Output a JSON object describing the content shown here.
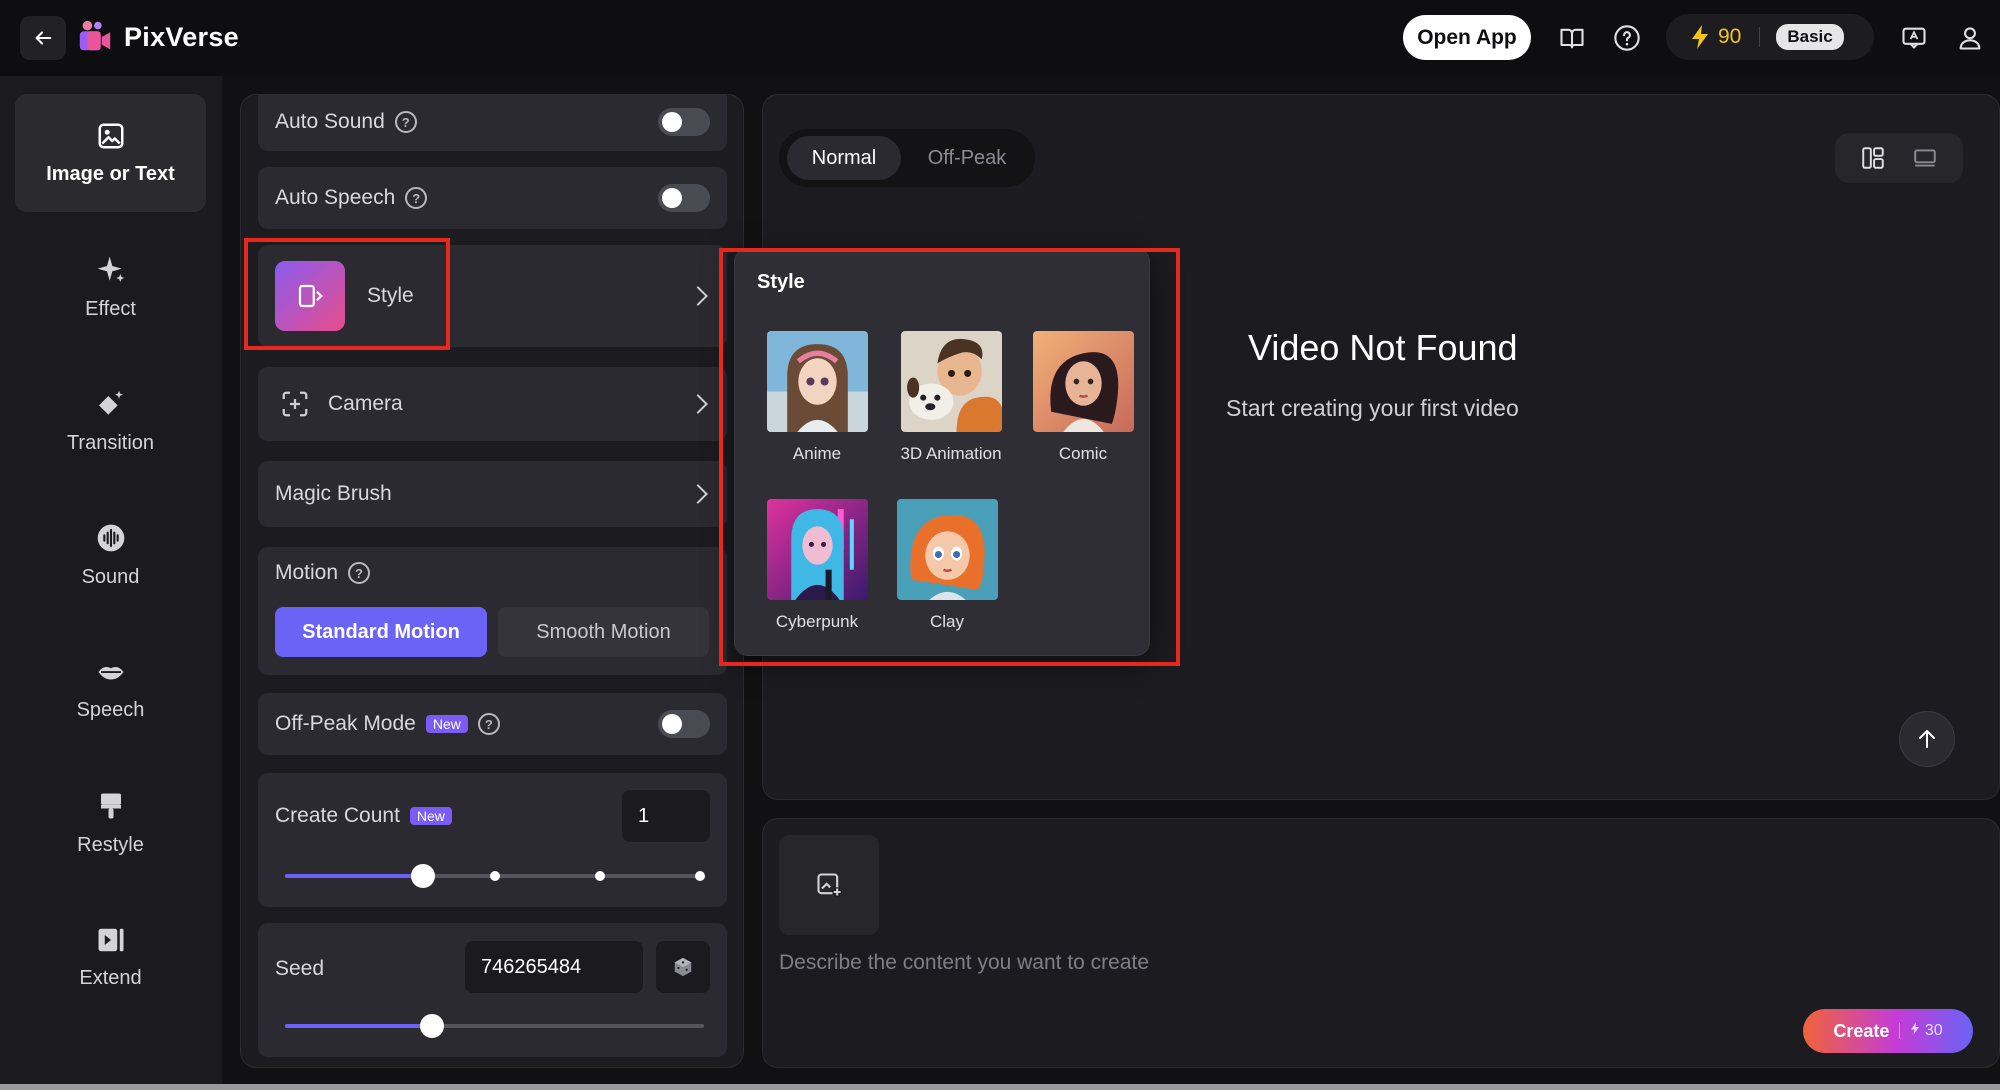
{
  "header": {
    "brand": "PixVerse",
    "open_app_label": "Open App",
    "credits_value": "90",
    "plan_label": "Basic",
    "icons": [
      "back-arrow-icon",
      "book-icon",
      "help-icon",
      "lightning-icon",
      "feedback-icon",
      "user-icon"
    ]
  },
  "rail": {
    "items": [
      {
        "label": "Image or Text",
        "icon": "image-icon"
      },
      {
        "label": "Effect",
        "icon": "sparkle-icon"
      },
      {
        "label": "Transition",
        "icon": "transition-icon"
      },
      {
        "label": "Sound",
        "icon": "sound-icon"
      },
      {
        "label": "Speech",
        "icon": "lips-icon"
      },
      {
        "label": "Restyle",
        "icon": "brush-icon"
      },
      {
        "label": "Extend",
        "icon": "extend-icon"
      }
    ]
  },
  "settings": {
    "auto_sound_label": "Auto Sound",
    "auto_speech_label": "Auto Speech",
    "style_label": "Style",
    "camera_label": "Camera",
    "magic_brush_label": "Magic Brush",
    "motion_label": "Motion",
    "motion_options": [
      "Standard Motion",
      "Smooth Motion"
    ],
    "off_peak_label": "Off-Peak Mode",
    "new_badge": "New",
    "create_count_label": "Create Count",
    "create_count_value": "1",
    "create_count_level": 0.33,
    "seed_label": "Seed",
    "seed_value": "746265484",
    "seed_level": 0.35
  },
  "preview": {
    "tabs": [
      "Normal",
      "Off-Peak"
    ],
    "empty_title": "Video Not Found",
    "empty_subtitle": "Start creating your first video"
  },
  "style_popover": {
    "title": "Style",
    "options": [
      "Anime",
      "3D Animation",
      "Comic",
      "Cyberpunk",
      "Clay"
    ]
  },
  "prompt": {
    "placeholder": "Describe the content you want to create",
    "create_label": "Create",
    "create_cost": "30"
  },
  "colors": {
    "accent": "#6a63f5",
    "highlight": "#e8271f",
    "credits": "#f5c518"
  }
}
